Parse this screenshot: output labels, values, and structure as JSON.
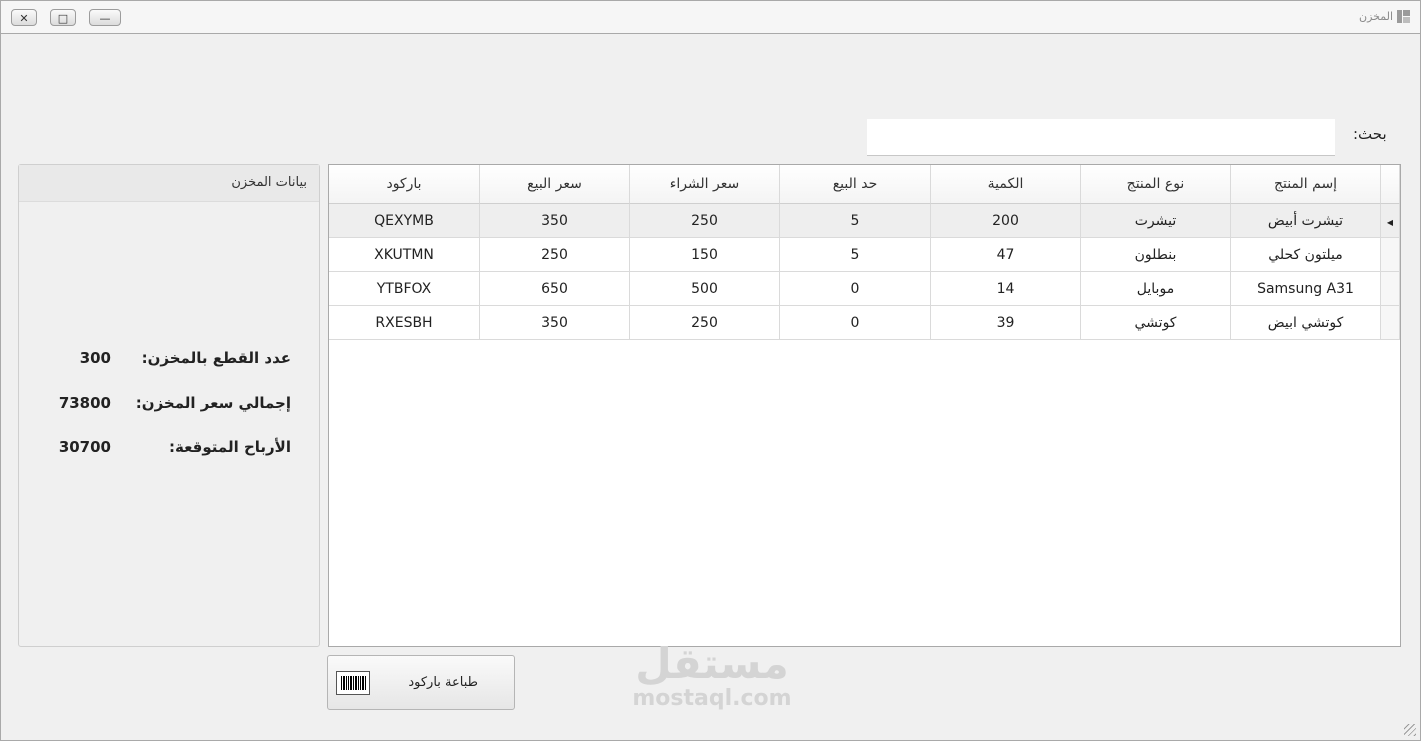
{
  "window": {
    "title": "المخزن",
    "controls": {
      "close": "✕",
      "maximize": "□",
      "minimize": "—"
    }
  },
  "search": {
    "label": "بحث:",
    "value": "",
    "placeholder": ""
  },
  "side_panel": {
    "title": "بيانات المخزن",
    "stats": [
      {
        "label": "عدد القطع بالمخزن:",
        "value": "300"
      },
      {
        "label": "إجمالي سعر المخزن:",
        "value": "73800"
      },
      {
        "label": "الأرباح المتوقعة:",
        "value": "30700"
      }
    ]
  },
  "table": {
    "columns": [
      "إسم المنتج",
      "نوع المنتج",
      "الكمية",
      "حد البيع",
      "سعر الشراء",
      "سعر البيع",
      "باركود"
    ],
    "rows": [
      [
        "تيشرت أبيض",
        "تيشرت",
        "200",
        "5",
        "250",
        "350",
        "QEXYMB"
      ],
      [
        "ميلتون كحلي",
        "بنطلون",
        "47",
        "5",
        "150",
        "250",
        "XKUTMN"
      ],
      [
        "Samsung A31",
        "موبايل",
        "14",
        "0",
        "500",
        "650",
        "YTBFOX"
      ],
      [
        "كوتشي ابيض",
        "كوتشي",
        "39",
        "0",
        "250",
        "350",
        "RXESBH"
      ]
    ],
    "selected_row": 0
  },
  "actions": {
    "print_barcode": "طباعة باركود"
  },
  "watermark": {
    "arabic": "مستقل",
    "latin": "mostaql.com"
  }
}
